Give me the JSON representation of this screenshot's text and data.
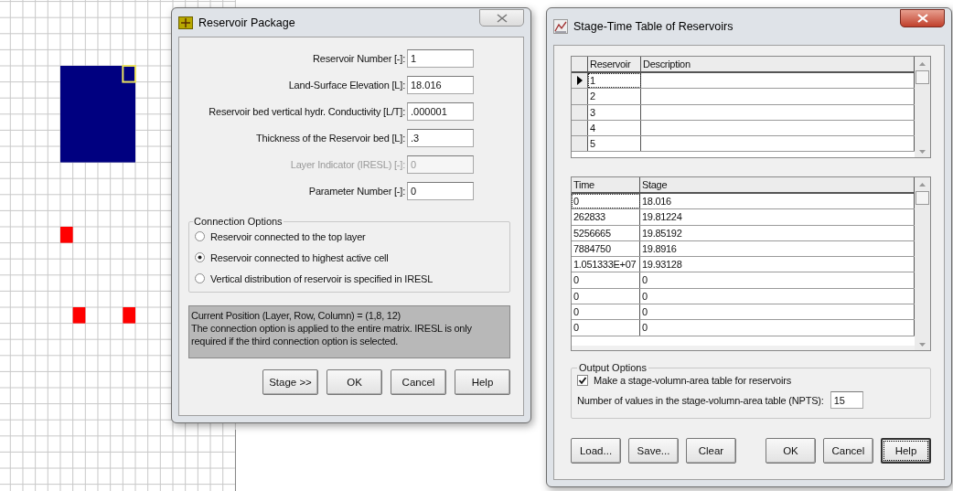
{
  "reservoir_dialog": {
    "title": "Reservoir Package",
    "fields": [
      {
        "label": "Reservoir Number [-]:",
        "value": "1",
        "disabled": false
      },
      {
        "label": "Land-Surface Elevation [L]:",
        "value": "18.016",
        "disabled": false
      },
      {
        "label": "Reservoir bed vertical hydr. Conductivity [L/T]:",
        "value": ".000001",
        "disabled": false
      },
      {
        "label": "Thickness of the Reservoir bed [L]:",
        "value": ".3",
        "disabled": false
      },
      {
        "label": "Layer Indicator (IRESL) [-]:",
        "value": "0",
        "disabled": true
      },
      {
        "label": "Parameter Number [-]:",
        "value": "0",
        "disabled": false
      }
    ],
    "connection_options": {
      "title": "Connection Options",
      "options": [
        {
          "label": "Reservoir connected to the top layer",
          "selected": false
        },
        {
          "label": "Reservoir connected to highest active cell",
          "selected": true
        },
        {
          "label": "Vertical distribution of reservoir is specified in IRESL",
          "selected": false
        }
      ]
    },
    "info": [
      "Current Position (Layer, Row, Column) = (1,8, 12)",
      "The connection option is applied to the entire matrix. IRESL is only required if the third connection option is selected."
    ],
    "buttons": [
      {
        "label": "Stage >>",
        "focused": false
      },
      {
        "label": "OK",
        "focused": false
      },
      {
        "label": "Cancel",
        "focused": false
      },
      {
        "label": "Help",
        "focused": false
      }
    ]
  },
  "stage_dialog": {
    "title": "Stage-Time Table of Reservoirs",
    "reservoir_table": {
      "columns": [
        "Reservoir",
        "Description"
      ],
      "rows": [
        {
          "reservoir": "1",
          "description": "",
          "selected": true
        },
        {
          "reservoir": "2",
          "description": "",
          "selected": false
        },
        {
          "reservoir": "3",
          "description": "",
          "selected": false
        },
        {
          "reservoir": "4",
          "description": "",
          "selected": false
        },
        {
          "reservoir": "5",
          "description": "",
          "selected": false
        }
      ]
    },
    "stage_table": {
      "columns": [
        "Time",
        "Stage"
      ],
      "rows": [
        {
          "time": "0",
          "stage": "18.016",
          "selected": true
        },
        {
          "time": "262833",
          "stage": "19.81224",
          "selected": false
        },
        {
          "time": "5256665",
          "stage": "19.85192",
          "selected": false
        },
        {
          "time": "7884750",
          "stage": "19.8916",
          "selected": false
        },
        {
          "time": "1.051333E+07",
          "stage": "19.93128",
          "selected": false
        },
        {
          "time": "0",
          "stage": "0",
          "selected": false
        },
        {
          "time": "0",
          "stage": "0",
          "selected": false
        },
        {
          "time": "0",
          "stage": "0",
          "selected": false
        },
        {
          "time": "0",
          "stage": "0",
          "selected": false
        }
      ]
    },
    "output_options": {
      "title": "Output Options",
      "checkbox": {
        "label": "Make a stage-volumn-area table for reservoirs",
        "checked": true
      },
      "npts": {
        "label": "Number of values in the stage-volumn-area table (NPTS):",
        "value": "15"
      }
    },
    "buttons": [
      {
        "label": "Load...",
        "focused": false
      },
      {
        "label": "Save...",
        "focused": false
      },
      {
        "label": "Clear",
        "focused": false
      },
      {
        "label": "OK",
        "focused": false
      },
      {
        "label": "Cancel",
        "focused": false
      },
      {
        "label": "Help",
        "focused": true
      }
    ]
  }
}
